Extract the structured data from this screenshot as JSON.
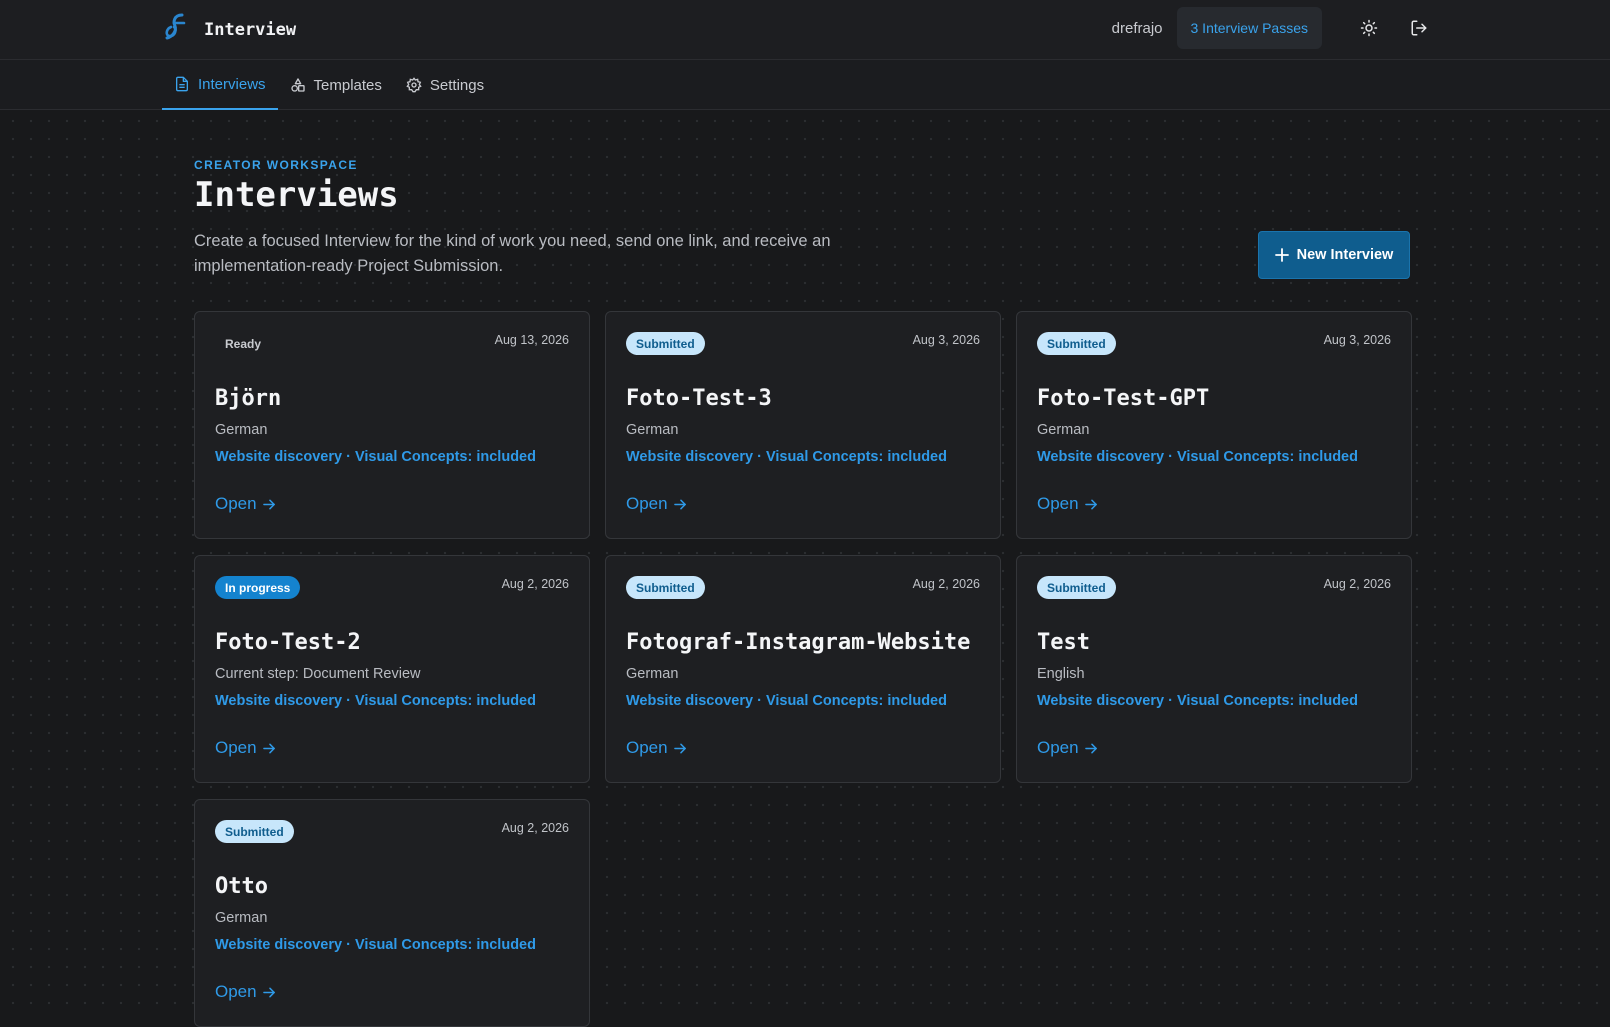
{
  "header": {
    "app_name": "Interview",
    "username": "drefrajo",
    "passes": "3 Interview Passes",
    "theme_icon": "sun-icon",
    "logout_icon": "logout-icon"
  },
  "tabs": [
    {
      "label": "Interviews",
      "icon": "document-icon",
      "active": true
    },
    {
      "label": "Templates",
      "icon": "shapes-icon",
      "active": false
    },
    {
      "label": "Settings",
      "icon": "gear-icon",
      "active": false
    }
  ],
  "page": {
    "eyebrow": "CREATOR WORKSPACE",
    "title": "Interviews",
    "description": "Create a focused Interview for the kind of work you need, send one link, and receive an implementation-ready Project Submission.",
    "new_button": "New Interview"
  },
  "cards": [
    {
      "status": "Ready",
      "date": "Aug 13, 2026",
      "title": "Björn",
      "subtitle": "German",
      "meta": "Website discovery · Visual Concepts: included",
      "open": "Open"
    },
    {
      "status": "Submitted",
      "date": "Aug 3, 2026",
      "title": "Foto-Test-3",
      "subtitle": "German",
      "meta": "Website discovery · Visual Concepts: included",
      "open": "Open"
    },
    {
      "status": "Submitted",
      "date": "Aug 3, 2026",
      "title": "Foto-Test-GPT",
      "subtitle": "German",
      "meta": "Website discovery · Visual Concepts: included",
      "open": "Open"
    },
    {
      "status": "In progress",
      "date": "Aug 2, 2026",
      "title": "Foto-Test-2",
      "subtitle": "Current step: Document Review",
      "meta": "Website discovery · Visual Concepts: included",
      "open": "Open"
    },
    {
      "status": "Submitted",
      "date": "Aug 2, 2026",
      "title": "Fotograf-Instagram-Website",
      "subtitle": "German",
      "meta": "Website discovery · Visual Concepts: included",
      "open": "Open"
    },
    {
      "status": "Submitted",
      "date": "Aug 2, 2026",
      "title": "Test",
      "subtitle": "English",
      "meta": "Website discovery · Visual Concepts: included",
      "open": "Open"
    },
    {
      "status": "Submitted",
      "date": "Aug 2, 2026",
      "title": "Otto",
      "subtitle": "German",
      "meta": "Website discovery · Visual Concepts: included",
      "open": "Open"
    }
  ],
  "colors": {
    "accent": "#3aa3ec",
    "background": "#18191b",
    "card": "#1e1f22",
    "primary_button": "#0f5d8e",
    "badge_submitted": "#c7e6fb",
    "badge_in_progress": "#1483cf"
  }
}
